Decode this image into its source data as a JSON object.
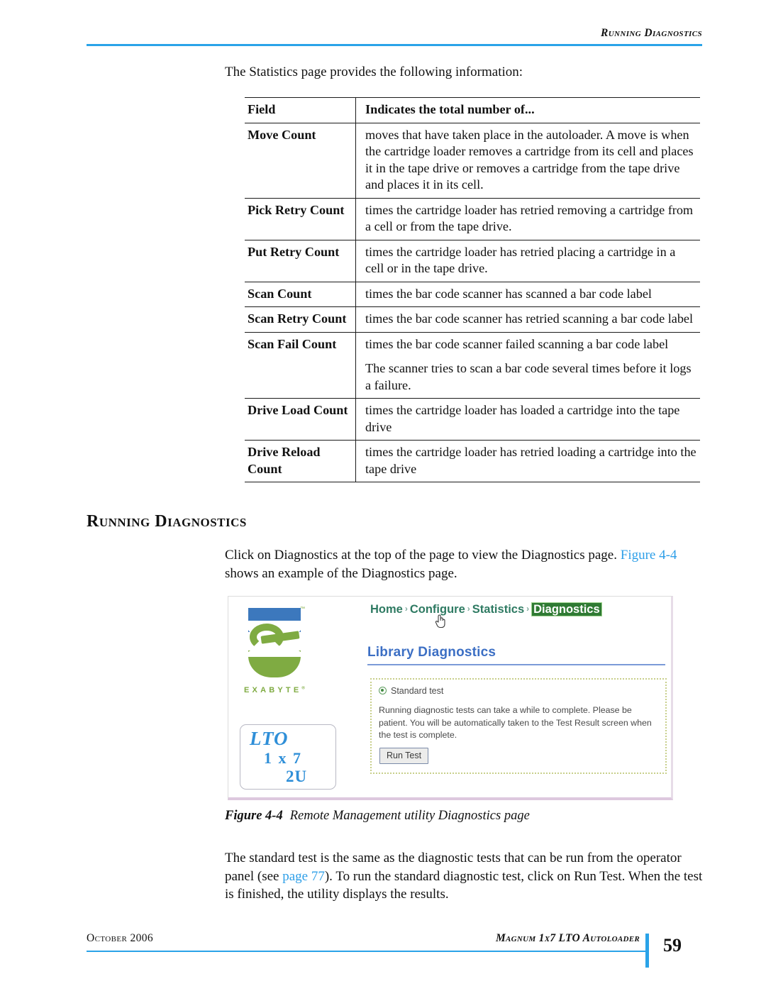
{
  "header": {
    "running_head": "Running Diagnostics"
  },
  "intro": {
    "text": "The Statistics page provides the following information:"
  },
  "table": {
    "headers": [
      "Field",
      "Indicates the total number of..."
    ],
    "rows": [
      {
        "field": "Move Count",
        "description": "moves that have taken place in the autoloader. A move is when the cartridge loader removes a cartridge from its cell and places it in the tape drive or removes a cartridge from the tape drive and places it in its cell."
      },
      {
        "field": "Pick Retry Count",
        "description": "times the cartridge loader has retried removing a cartridge from a cell or from the tape drive."
      },
      {
        "field": "Put Retry Count",
        "description": "times the cartridge loader has retried placing a cartridge in a cell or in the tape drive."
      },
      {
        "field": "Scan Count",
        "description": "times the bar code scanner has scanned a bar code label"
      },
      {
        "field": "Scan Retry Count",
        "description": "times the bar code scanner has retried scanning a bar code label"
      },
      {
        "field": "Scan Fail Count",
        "description": "times the bar code scanner failed scanning a bar code label"
      },
      {
        "field": "",
        "description": "The scanner tries to scan a bar code several times before it logs a failure."
      },
      {
        "field": "Drive Load Count",
        "description": "times the cartridge loader has loaded a cartridge into the tape drive"
      },
      {
        "field": "Drive Reload Count",
        "description": "times the cartridge loader has retried loading a cartridge into the tape drive"
      }
    ]
  },
  "section": {
    "heading": "Running Diagnostics",
    "para_click_part1": "Click on Diagnostics at the top of the page to view the Diagnostics page. ",
    "para_click_link": "Figure 4-4",
    "para_click_part2": " shows an example of the Diagnostics page."
  },
  "figure": {
    "caption_number": "Figure 4-4",
    "caption_text": "Remote Management utility Diagnostics page",
    "screenshot": {
      "logo": {
        "wordmark": "EXABYTE",
        "tm": "™",
        "registered": "®"
      },
      "product_box": {
        "line1": "LTO",
        "line2": "1 x 7",
        "line3": "2U"
      },
      "nav": {
        "items": [
          "Home",
          "Configure",
          "Statistics",
          "Diagnostics"
        ],
        "active": "Diagnostics",
        "separator": "›"
      },
      "page_title": "Library Diagnostics",
      "panel": {
        "radio_label": "Standard test",
        "body_text": "Running diagnostic tests can take a while to complete. Please be patient. You will be automatically taken to the Test Result screen when the test is complete.",
        "button_label": "Run Test"
      }
    }
  },
  "para_standard": {
    "part1": "The standard test is the same as the diagnostic tests that can be run from the operator panel (see ",
    "link": "page 77",
    "part2": "). To run the standard diagnostic test, click on Run Test. When the test is finished, the utility displays the results."
  },
  "footer": {
    "left": "October 2006",
    "right": "Magnum 1x7 LTO Autoloader",
    "page_number": "59"
  },
  "colors": {
    "accent_blue": "#2aa3e8",
    "link_blue": "#2e9fe8",
    "nav_green": "#2e7a62",
    "nav_active_bg": "#2f7a33",
    "logo_green": "#7fab42",
    "logo_blue": "#3c78bd"
  }
}
